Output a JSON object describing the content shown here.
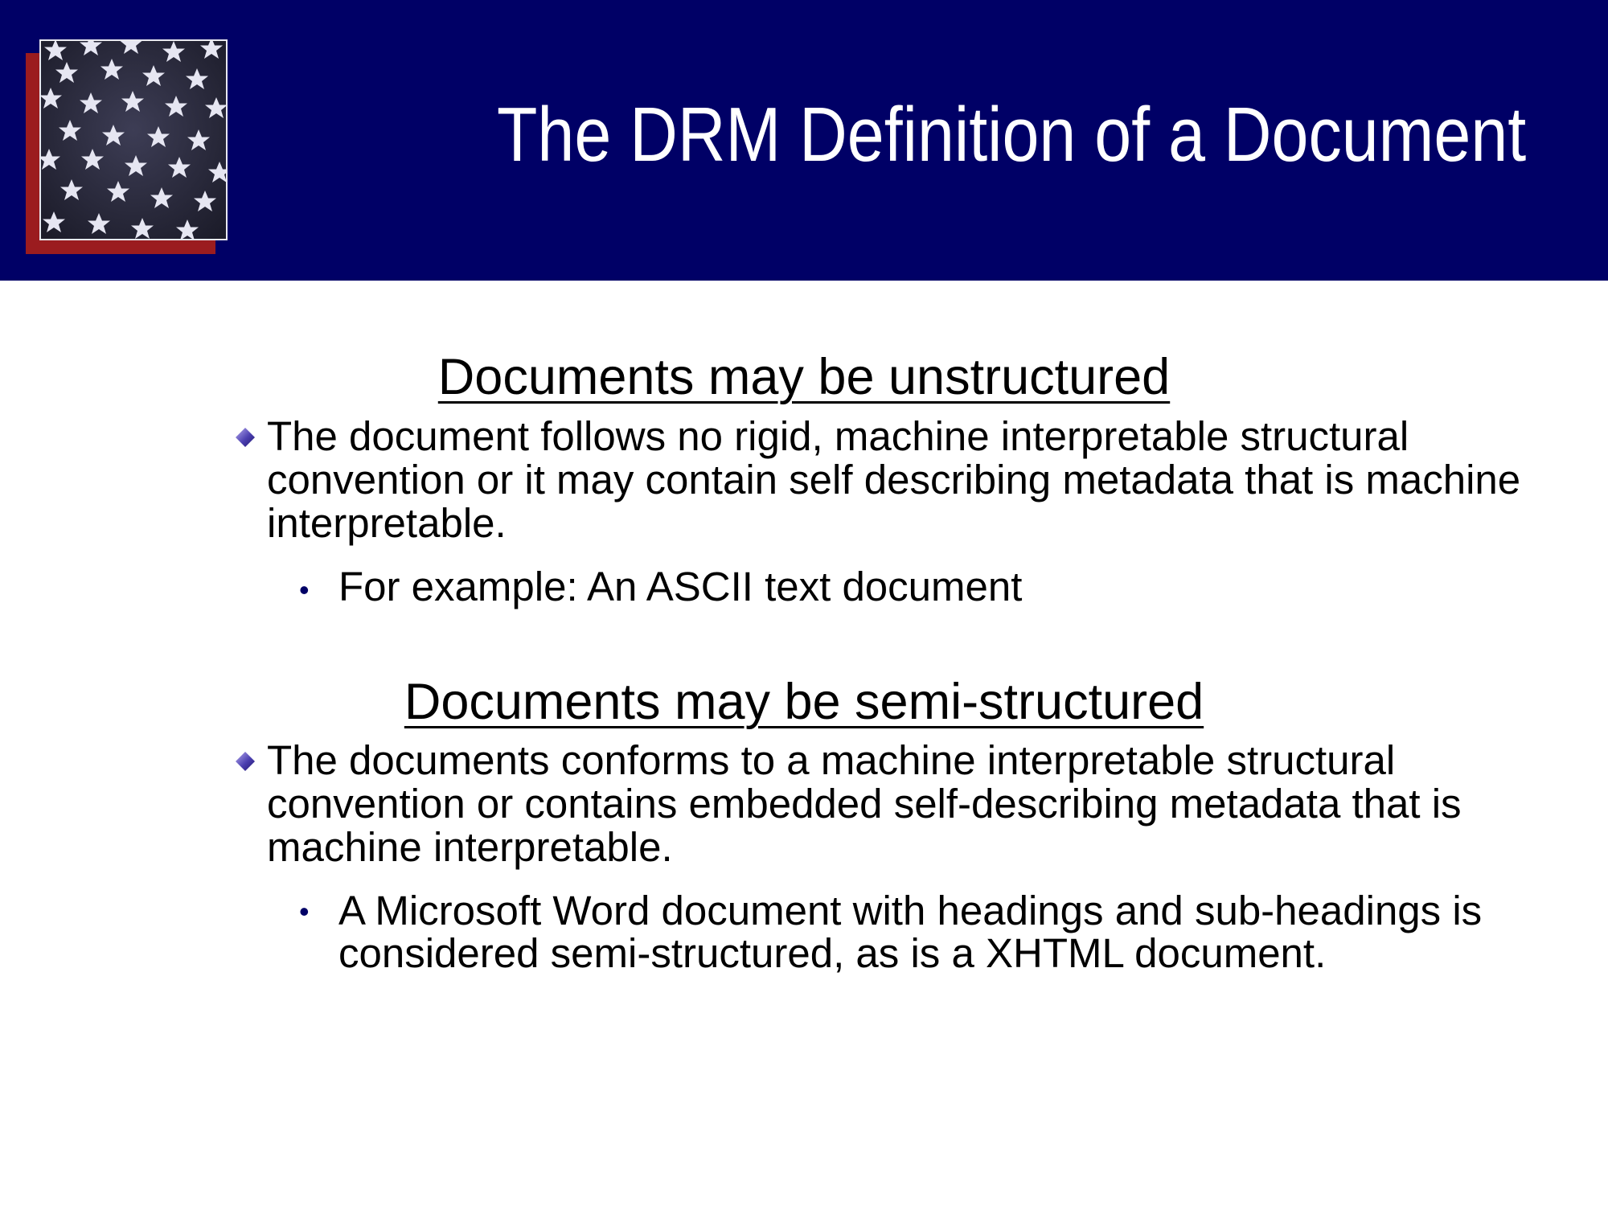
{
  "title": "The DRM Definition of a Document",
  "sections": [
    {
      "heading": "Documents may be unstructured",
      "bullet": "The document follows no rigid, machine interpretable structural convention or it may contain self describing metadata that is machine interpretable.",
      "sub_bullet": "For example: An ASCII text document"
    },
    {
      "heading": "Documents may be semi-structured",
      "bullet": "The documents conforms to a machine interpretable structural convention or contains embedded self-describing metadata that is machine interpretable.",
      "sub_bullet": "A Microsoft Word document with headings and sub-headings is considered semi-structured, as is a XHTML document."
    }
  ],
  "colors": {
    "header_band": "#000066",
    "logo_shadow": "#9b1c1f",
    "bullet_diamond": "#4b3fb0",
    "text": "#000000"
  },
  "icons": {
    "logo": "stars-flag-logo",
    "bullet": "diamond-bullet-icon",
    "sub_bullet": "dot-bullet"
  }
}
